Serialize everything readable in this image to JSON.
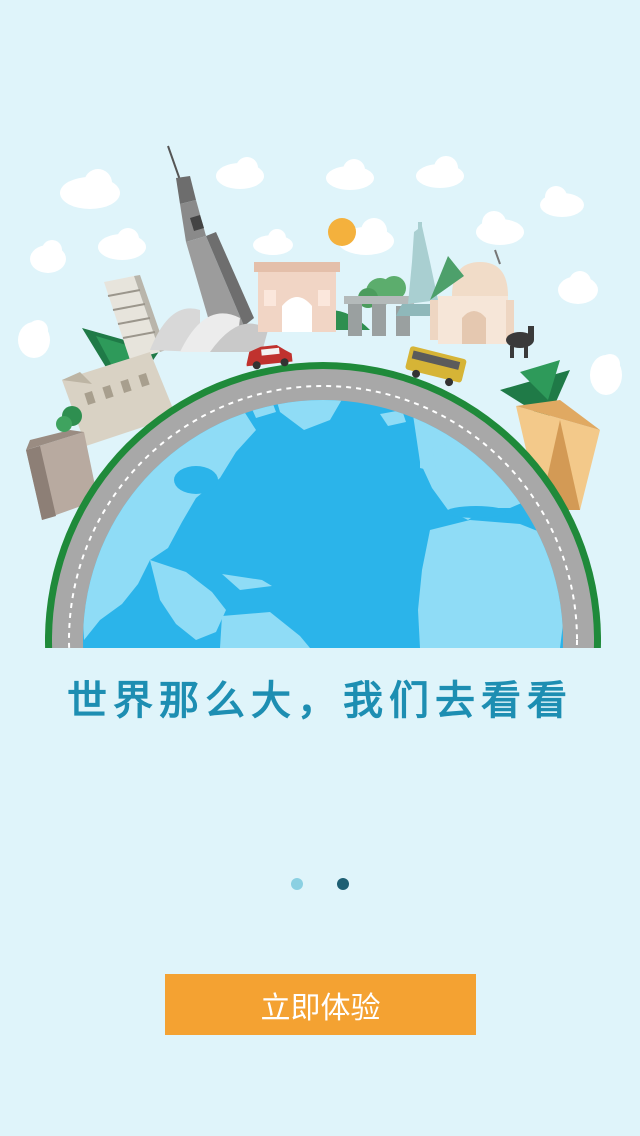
{
  "tagline": "世界那么大，我们去看看",
  "pager": {
    "total": 2,
    "current_index": 1
  },
  "cta": {
    "label": "立即体验"
  },
  "colors": {
    "background": "#dff4fa",
    "accent": "#f4a232",
    "tagline": "#1d8eb2",
    "ocean": "#2bb4ea",
    "land": "#8fdcf6",
    "road": "#a8a8a8",
    "grass": "#1f8a3a"
  }
}
